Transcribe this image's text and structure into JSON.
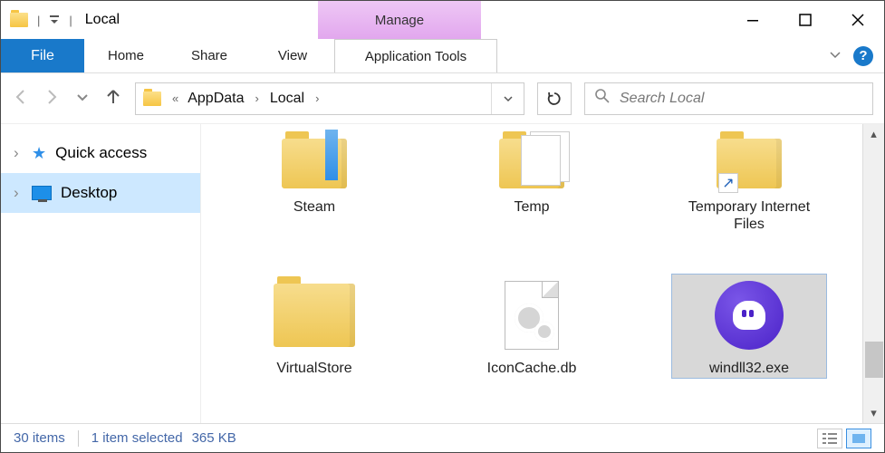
{
  "window": {
    "title": "Local",
    "context_tab": "Manage"
  },
  "ribbon": {
    "file": "File",
    "tabs": [
      "Home",
      "Share",
      "View"
    ],
    "context_tool": "Application Tools"
  },
  "breadcrumb": {
    "parts": [
      "AppData",
      "Local"
    ],
    "truncated_prefix": "«"
  },
  "search": {
    "placeholder": "Search Local"
  },
  "sidebar": {
    "items": [
      {
        "label": "Quick access"
      },
      {
        "label": "Desktop"
      }
    ]
  },
  "items": {
    "row1": [
      {
        "name": "Steam",
        "kind": "folder-steam"
      },
      {
        "name": "Temp",
        "kind": "folder-papers"
      },
      {
        "name": "Temporary Internet Files",
        "kind": "folder-shortcut"
      }
    ],
    "row2": [
      {
        "name": "VirtualStore",
        "kind": "folder"
      },
      {
        "name": "IconCache.db",
        "kind": "gearfile"
      },
      {
        "name": "windll32.exe",
        "kind": "app",
        "selected": true
      }
    ]
  },
  "status": {
    "count_label": "30 items",
    "selection_label": "1 item selected",
    "size_label": "365 KB"
  }
}
